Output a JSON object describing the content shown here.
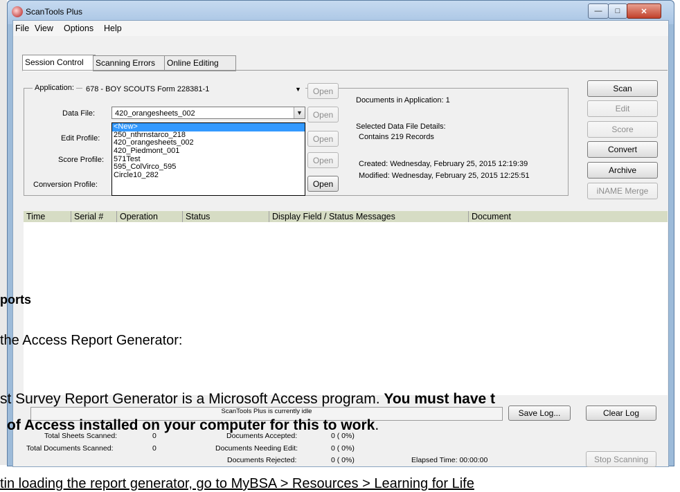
{
  "window": {
    "title": "ScanTools Plus",
    "minimize": "—",
    "maximize": "□",
    "close": "✕"
  },
  "menu": [
    "File",
    "View",
    "Options",
    "Help"
  ],
  "tabs": [
    "Session Control",
    "Scanning Errors",
    "Online Editing"
  ],
  "form": {
    "application_label": "Application:",
    "application_value": "678 - BOY SCOUTS Form 228381-1",
    "data_file_label": "Data File:",
    "data_file_value": "420_orangesheets_002",
    "edit_profile_label": "Edit Profile:",
    "score_profile_label": "Score Profile:",
    "conversion_profile_label": "Conversion Profile:",
    "open_label": "Open"
  },
  "dropdown_items": [
    "<New>",
    "250_nthrnstarco_218",
    "420_orangesheets_002",
    "420_Piedmont_001",
    "571Test",
    "595_ColVirco_595",
    "Circle10_282"
  ],
  "info": {
    "docs_in_app": "Documents in Application: 1",
    "selected_details": "Selected Data File Details:",
    "contains": "Contains 219 Records",
    "created": "Created: Wednesday, February 25, 2015 12:19:39",
    "modified": "Modified: Wednesday, February 25, 2015 12:25:51"
  },
  "side_buttons": {
    "scan": "Scan",
    "edit": "Edit",
    "score": "Score",
    "convert": "Convert",
    "archive": "Archive",
    "iname_merge": "iNAME Merge"
  },
  "log_columns": [
    "Time",
    "Serial #",
    "Operation",
    "Status",
    "Display Field / Status Messages",
    "Document"
  ],
  "status": {
    "idle_text": "ScanTools Plus is currently idle",
    "save_log": "Save Log...",
    "clear_log": "Clear Log",
    "total_sheets_label": "Total Sheets Scanned:",
    "total_sheets_value": "0",
    "total_docs_label": "Total Documents Scanned:",
    "total_docs_value": "0",
    "accepted_label": "Documents Accepted:",
    "accepted_value": "0 ( 0%)",
    "needing_edit_label": "Documents Needing Edit:",
    "needing_edit_value": "0 ( 0%)",
    "rejected_label": "Documents Rejected:",
    "rejected_value": "0 ( 0%)",
    "elapsed": "Elapsed Time: 00:00:00",
    "stop_scanning": "Stop Scanning"
  },
  "overlay": {
    "heading": "ports",
    "line1": "the Access Report Generator:",
    "line2_a": "st Survey Report Generator is a Microsoft Access program. ",
    "line2_b": "You must have t",
    "line3_a": "of Access installed on your computer for this to work",
    "line3_b": ".",
    "line4": "tin loading the report generator, go to MyBSA > Resources > Learning for Life"
  }
}
